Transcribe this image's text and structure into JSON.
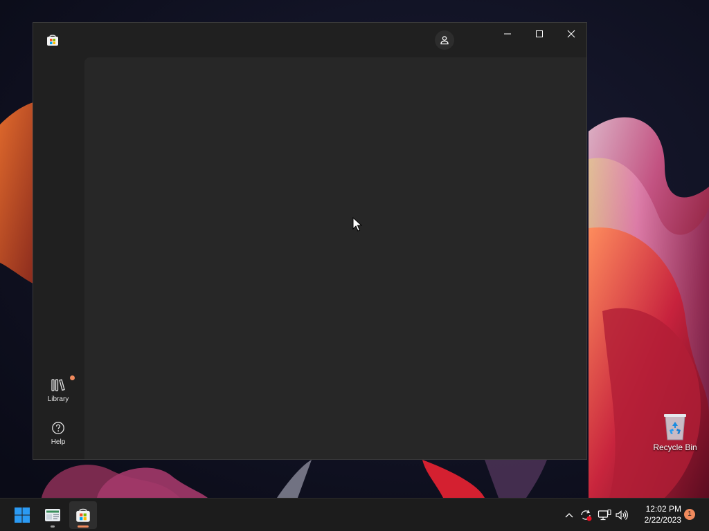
{
  "desktop": {
    "recycle_bin_label": "Recycle Bin"
  },
  "window": {
    "app": "Microsoft Store",
    "nav": {
      "library_label": "Library",
      "help_label": "Help"
    }
  },
  "taskbar": {
    "clock_time": "12:02 PM",
    "clock_date": "2/22/2023",
    "notification_count": "1"
  },
  "colors": {
    "accent": "#f08a5d",
    "window_bg": "#202020",
    "content_bg": "#272727",
    "taskbar_bg": "#1c1c1c"
  }
}
